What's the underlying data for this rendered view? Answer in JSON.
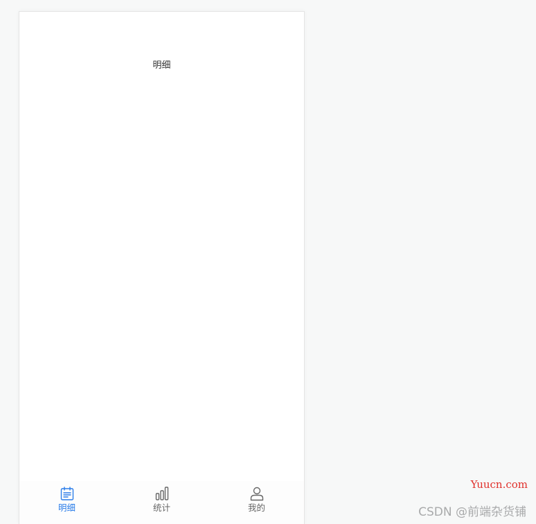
{
  "page": {
    "title": "明细"
  },
  "tabbar": {
    "active_color": "#2b7de9",
    "inactive_color": "#666666",
    "tabs": [
      {
        "label": "明细",
        "icon": "calendar-list-icon",
        "active": true
      },
      {
        "label": "统计",
        "icon": "bar-chart-icon",
        "active": false
      },
      {
        "label": "我的",
        "icon": "user-icon",
        "active": false
      }
    ]
  },
  "watermarks": {
    "site": "Yuucn.com",
    "csdn": "CSDN @前端杂货铺"
  }
}
